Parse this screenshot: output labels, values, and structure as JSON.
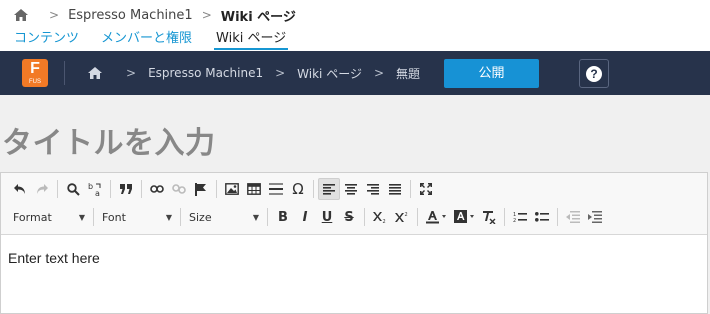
{
  "breadcrumb": {
    "project": "Espresso Machine1",
    "current": "Wiki ページ"
  },
  "tabs": [
    {
      "label": "コンテンツ"
    },
    {
      "label": "メンバーと権限"
    },
    {
      "label": "Wiki ページ",
      "active": true
    }
  ],
  "navbar": {
    "logo_letter": "F",
    "logo_sub": "FUS",
    "crumbs": [
      "Espresso Machine1",
      "Wiki ページ",
      "無題"
    ],
    "publish_label": "公開",
    "help_label": "?"
  },
  "page": {
    "title_placeholder": "タイトルを入力"
  },
  "toolbar": {
    "format_label": "Format",
    "font_label": "Font",
    "size_label": "Size",
    "bold": "B",
    "italic": "I",
    "underline": "U",
    "strike": "S"
  },
  "editor": {
    "placeholder": "Enter text here"
  },
  "colors": {
    "navbar_bg": "#27334b",
    "accent": "#1696d2",
    "publish_bg": "#1792d5",
    "logo_bg": "#f27a26"
  }
}
